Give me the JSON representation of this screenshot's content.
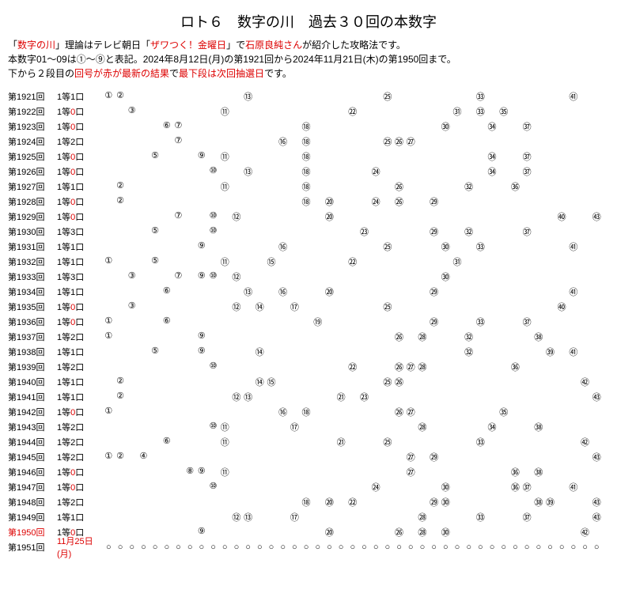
{
  "title": "ロト６　数字の川　過去３０回の本数字",
  "intro": {
    "p1a": "「",
    "p1b": "数字の川",
    "p1c": "」理論はテレビ朝日「",
    "p1d": "ザワつく！金曜日",
    "p1e": "」で",
    "p1f": "石原良純さん",
    "p1g": "が紹介した攻略法です。",
    "p2": "本数字01〜09は①〜⑨と表記。2024年8月12日(月)の第1921回から2024年11月21日(木)の第1950回まで。",
    "p3a": "下から２段目の",
    "p3b": "回号が赤が最新の結果",
    "p3c": "で",
    "p3d": "最下段は次回抽選日",
    "p3e": "です。"
  },
  "circled": [
    "",
    "①",
    "②",
    "③",
    "④",
    "⑤",
    "⑥",
    "⑦",
    "⑧",
    "⑨",
    "⑩",
    "⑪",
    "⑫",
    "⑬",
    "⑭",
    "⑮",
    "⑯",
    "⑰",
    "⑱",
    "⑲",
    "⑳",
    "㉑",
    "㉒",
    "㉓",
    "㉔",
    "㉕",
    "㉖",
    "㉗",
    "㉘",
    "㉙",
    "㉚",
    "㉛",
    "㉜",
    "㉝",
    "㉞",
    "㉟",
    "㊱",
    "㊲",
    "㊳",
    "㊴",
    "㊵",
    "㊶",
    "㊷",
    "㊸"
  ],
  "open_circle": "○",
  "prize_prefix": "1等",
  "prize_suffix": "口",
  "draw_prefix": "第",
  "draw_suffix": "回",
  "rows": [
    {
      "draw": 1921,
      "prize": 1,
      "nums": [
        1,
        2,
        13,
        25,
        33,
        41
      ]
    },
    {
      "draw": 1922,
      "prize": 0,
      "nums": [
        3,
        11,
        22,
        31,
        33,
        35
      ]
    },
    {
      "draw": 1923,
      "prize": 0,
      "nums": [
        6,
        7,
        18,
        30,
        34,
        37
      ]
    },
    {
      "draw": 1924,
      "prize": 2,
      "nums": [
        7,
        16,
        18,
        25,
        26,
        27
      ]
    },
    {
      "draw": 1925,
      "prize": 0,
      "nums": [
        5,
        9,
        11,
        18,
        34,
        37
      ]
    },
    {
      "draw": 1926,
      "prize": 0,
      "nums": [
        10,
        13,
        18,
        24,
        34,
        37
      ]
    },
    {
      "draw": 1927,
      "prize": 1,
      "nums": [
        2,
        11,
        18,
        26,
        32,
        36
      ]
    },
    {
      "draw": 1928,
      "prize": 0,
      "nums": [
        2,
        18,
        20,
        24,
        26,
        29
      ]
    },
    {
      "draw": 1929,
      "prize": 0,
      "nums": [
        7,
        10,
        12,
        20,
        40,
        43
      ]
    },
    {
      "draw": 1930,
      "prize": 3,
      "nums": [
        5,
        10,
        23,
        29,
        32,
        37
      ]
    },
    {
      "draw": 1931,
      "prize": 1,
      "nums": [
        9,
        16,
        25,
        30,
        33,
        41
      ]
    },
    {
      "draw": 1932,
      "prize": 1,
      "nums": [
        1,
        5,
        11,
        15,
        22,
        31
      ]
    },
    {
      "draw": 1933,
      "prize": 3,
      "nums": [
        3,
        7,
        9,
        10,
        12,
        30
      ]
    },
    {
      "draw": 1934,
      "prize": 1,
      "nums": [
        6,
        13,
        16,
        20,
        29,
        41
      ]
    },
    {
      "draw": 1935,
      "prize": 0,
      "nums": [
        3,
        12,
        14,
        17,
        25,
        40
      ]
    },
    {
      "draw": 1936,
      "prize": 0,
      "nums": [
        1,
        6,
        19,
        29,
        33,
        37
      ]
    },
    {
      "draw": 1937,
      "prize": 2,
      "nums": [
        1,
        9,
        26,
        28,
        32,
        38
      ]
    },
    {
      "draw": 1938,
      "prize": 1,
      "nums": [
        5,
        9,
        14,
        32,
        39,
        41
      ]
    },
    {
      "draw": 1939,
      "prize": 2,
      "nums": [
        10,
        22,
        26,
        27,
        28,
        36
      ]
    },
    {
      "draw": 1940,
      "prize": 1,
      "nums": [
        2,
        14,
        15,
        25,
        26,
        42
      ]
    },
    {
      "draw": 1941,
      "prize": 1,
      "nums": [
        2,
        12,
        13,
        21,
        23,
        43
      ]
    },
    {
      "draw": 1942,
      "prize": 0,
      "nums": [
        1,
        16,
        18,
        26,
        27,
        35
      ]
    },
    {
      "draw": 1943,
      "prize": 2,
      "nums": [
        10,
        11,
        17,
        28,
        34,
        38
      ]
    },
    {
      "draw": 1944,
      "prize": 2,
      "nums": [
        6,
        11,
        21,
        25,
        33,
        42
      ]
    },
    {
      "draw": 1945,
      "prize": 2,
      "nums": [
        1,
        2,
        4,
        27,
        29,
        43
      ]
    },
    {
      "draw": 1946,
      "prize": 0,
      "nums": [
        8,
        9,
        11,
        27,
        36,
        38
      ]
    },
    {
      "draw": 1947,
      "prize": 0,
      "nums": [
        10,
        24,
        30,
        36,
        37,
        41
      ]
    },
    {
      "draw": 1948,
      "prize": 2,
      "nums": [
        18,
        20,
        22,
        29,
        30,
        38,
        39,
        43
      ]
    },
    {
      "draw": 1949,
      "prize": 1,
      "nums": [
        12,
        13,
        17,
        28,
        33,
        37,
        43
      ]
    },
    {
      "draw": 1950,
      "prize": 0,
      "nums": [
        9,
        20,
        26,
        28,
        30,
        42
      ],
      "latest": true
    }
  ],
  "next": {
    "draw": 1951,
    "date": "11月25日(月)"
  }
}
